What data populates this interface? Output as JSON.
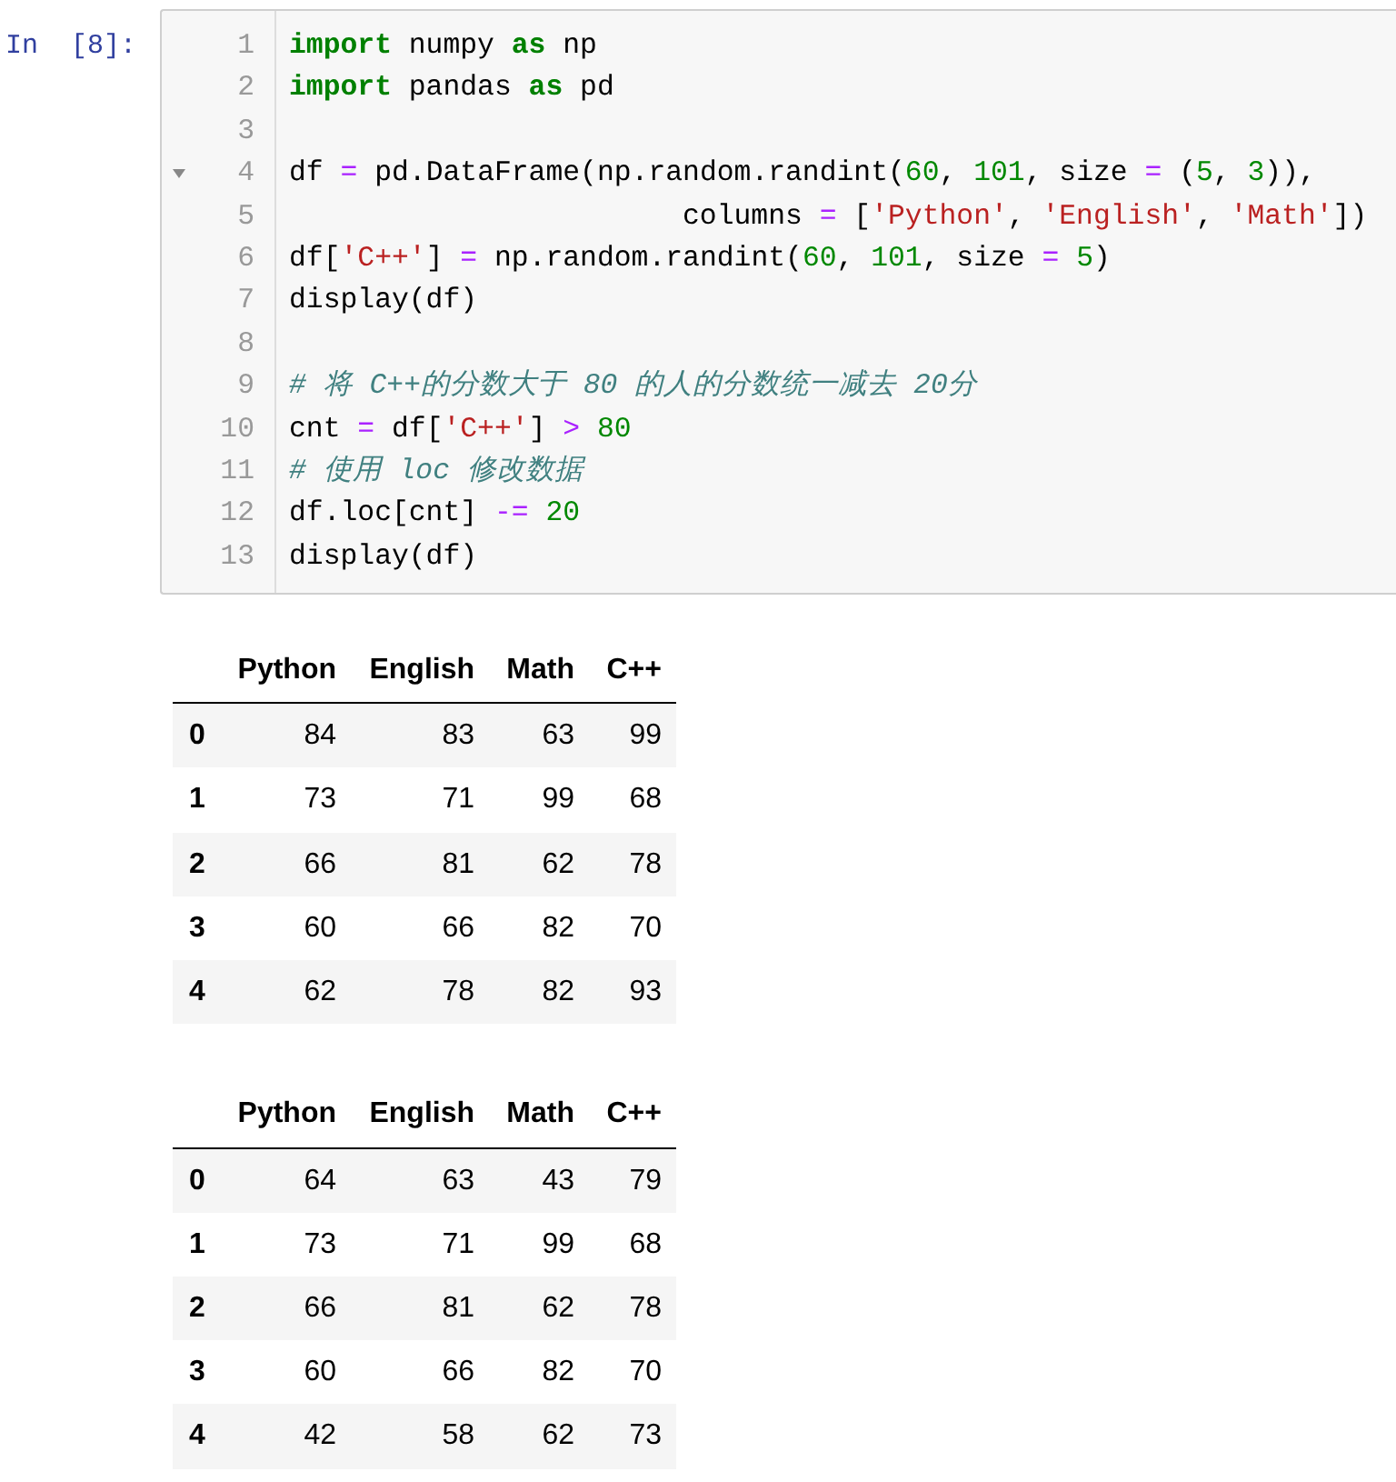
{
  "code_cell": {
    "prompt": "In  [8]:",
    "lines": [
      {
        "number": "1",
        "foldable": false,
        "tokens": [
          {
            "kind": "keyword",
            "text": "import"
          },
          {
            "kind": "text",
            "text": " numpy "
          },
          {
            "kind": "keyword",
            "text": "as"
          },
          {
            "kind": "text",
            "text": " np"
          }
        ]
      },
      {
        "number": "2",
        "foldable": false,
        "tokens": [
          {
            "kind": "keyword",
            "text": "import"
          },
          {
            "kind": "text",
            "text": " pandas "
          },
          {
            "kind": "keyword",
            "text": "as"
          },
          {
            "kind": "text",
            "text": " pd"
          }
        ]
      },
      {
        "number": "3",
        "foldable": false
      },
      {
        "number": "4",
        "foldable": true,
        "tokens": [
          {
            "kind": "text",
            "text": "df "
          },
          {
            "kind": "operator",
            "text": "="
          },
          {
            "kind": "text",
            "text": " pd.DataFrame(np.random.randint("
          },
          {
            "kind": "number",
            "text": "60"
          },
          {
            "kind": "text",
            "text": ", "
          },
          {
            "kind": "number",
            "text": "101"
          },
          {
            "kind": "text",
            "text": ", size "
          },
          {
            "kind": "operator",
            "text": "="
          },
          {
            "kind": "text",
            "text": " ("
          },
          {
            "kind": "number",
            "text": "5"
          },
          {
            "kind": "text",
            "text": ", "
          },
          {
            "kind": "number",
            "text": "3"
          },
          {
            "kind": "text",
            "text": ")),"
          }
        ]
      },
      {
        "number": "5",
        "foldable": false,
        "tokens": [
          {
            "kind": "text",
            "text": "                       columns "
          },
          {
            "kind": "operator",
            "text": "="
          },
          {
            "kind": "text",
            "text": " ["
          },
          {
            "kind": "string",
            "text": "'Python'"
          },
          {
            "kind": "text",
            "text": ", "
          },
          {
            "kind": "string",
            "text": "'English'"
          },
          {
            "kind": "text",
            "text": ", "
          },
          {
            "kind": "string",
            "text": "'Math'"
          },
          {
            "kind": "text",
            "text": "])"
          }
        ]
      },
      {
        "number": "6",
        "foldable": false,
        "tokens": [
          {
            "kind": "text",
            "text": "df["
          },
          {
            "kind": "string",
            "text": "'C++'"
          },
          {
            "kind": "text",
            "text": "] "
          },
          {
            "kind": "operator",
            "text": "="
          },
          {
            "kind": "text",
            "text": " np.random.randint("
          },
          {
            "kind": "number",
            "text": "60"
          },
          {
            "kind": "text",
            "text": ", "
          },
          {
            "kind": "number",
            "text": "101"
          },
          {
            "kind": "text",
            "text": ", size "
          },
          {
            "kind": "operator",
            "text": "= "
          },
          {
            "kind": "number",
            "text": "5"
          },
          {
            "kind": "text",
            "text": ")"
          }
        ]
      },
      {
        "number": "7",
        "foldable": false,
        "tokens": [
          {
            "kind": "text",
            "text": "display(df)"
          }
        ]
      },
      {
        "number": "8",
        "foldable": false
      },
      {
        "number": "9",
        "foldable": false,
        "tokens": [
          {
            "kind": "comment",
            "text": "# 将 C++的分数大于 80 的人的分数统一减去 20分"
          }
        ]
      },
      {
        "number": "10",
        "foldable": false,
        "tokens": [
          {
            "kind": "text",
            "text": "cnt "
          },
          {
            "kind": "operator",
            "text": "="
          },
          {
            "kind": "text",
            "text": " df["
          },
          {
            "kind": "string",
            "text": "'C++'"
          },
          {
            "kind": "text",
            "text": "] "
          },
          {
            "kind": "operator",
            "text": "> "
          },
          {
            "kind": "number",
            "text": "80"
          }
        ]
      },
      {
        "number": "11",
        "foldable": false,
        "tokens": [
          {
            "kind": "comment",
            "text": "# 使用 loc 修改数据"
          }
        ]
      },
      {
        "number": "12",
        "foldable": false,
        "tokens": [
          {
            "kind": "text",
            "text": "df.loc[cnt] "
          },
          {
            "kind": "operator",
            "text": "-= "
          },
          {
            "kind": "number",
            "text": "20"
          }
        ]
      },
      {
        "number": "13",
        "foldable": false,
        "tokens": [
          {
            "kind": "text",
            "text": "display(df)"
          }
        ]
      }
    ]
  },
  "outputs": [
    {
      "columns": [
        "Python",
        "English",
        "Math",
        "C++"
      ],
      "rows": [
        {
          "index": "0",
          "values": [
            "84",
            "83",
            "63",
            "99"
          ]
        },
        {
          "index": "1",
          "values": [
            "73",
            "71",
            "99",
            "68"
          ]
        },
        {
          "index": "2",
          "values": [
            "66",
            "81",
            "62",
            "78"
          ]
        },
        {
          "index": "3",
          "values": [
            "60",
            "66",
            "82",
            "70"
          ]
        },
        {
          "index": "4",
          "values": [
            "62",
            "78",
            "82",
            "93"
          ]
        }
      ]
    },
    {
      "columns": [
        "Python",
        "English",
        "Math",
        "C++"
      ],
      "rows": [
        {
          "index": "0",
          "values": [
            "64",
            "63",
            "43",
            "79"
          ]
        },
        {
          "index": "1",
          "values": [
            "73",
            "71",
            "99",
            "68"
          ]
        },
        {
          "index": "2",
          "values": [
            "66",
            "81",
            "62",
            "78"
          ]
        },
        {
          "index": "3",
          "values": [
            "60",
            "66",
            "82",
            "70"
          ]
        },
        {
          "index": "4",
          "values": [
            "42",
            "58",
            "62",
            "73"
          ]
        }
      ]
    }
  ]
}
